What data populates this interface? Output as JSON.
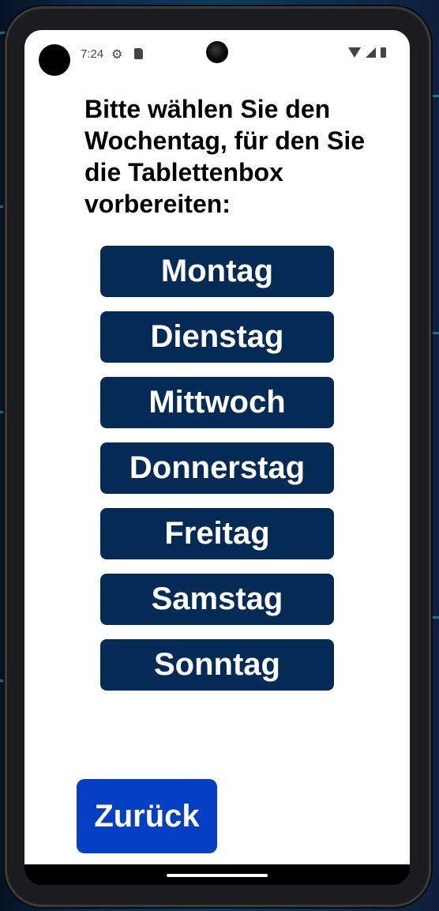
{
  "status_bar": {
    "time": "7:24",
    "icons": [
      "settings-icon",
      "sd-card-icon",
      "wifi-icon",
      "signal-icon",
      "battery-icon"
    ]
  },
  "heading": "Bitte wählen Sie den Wochentag, für den Sie die Tablettenbox vorbereiten:",
  "days": [
    {
      "label": "Montag"
    },
    {
      "label": "Dienstag"
    },
    {
      "label": "Mittwoch"
    },
    {
      "label": "Donnerstag"
    },
    {
      "label": "Freitag"
    },
    {
      "label": "Samstag"
    },
    {
      "label": "Sonntag"
    }
  ],
  "back_button": "Zurück",
  "colors": {
    "day_button": "#032b56",
    "back_button": "#0540c4",
    "background": "#ffffff"
  }
}
